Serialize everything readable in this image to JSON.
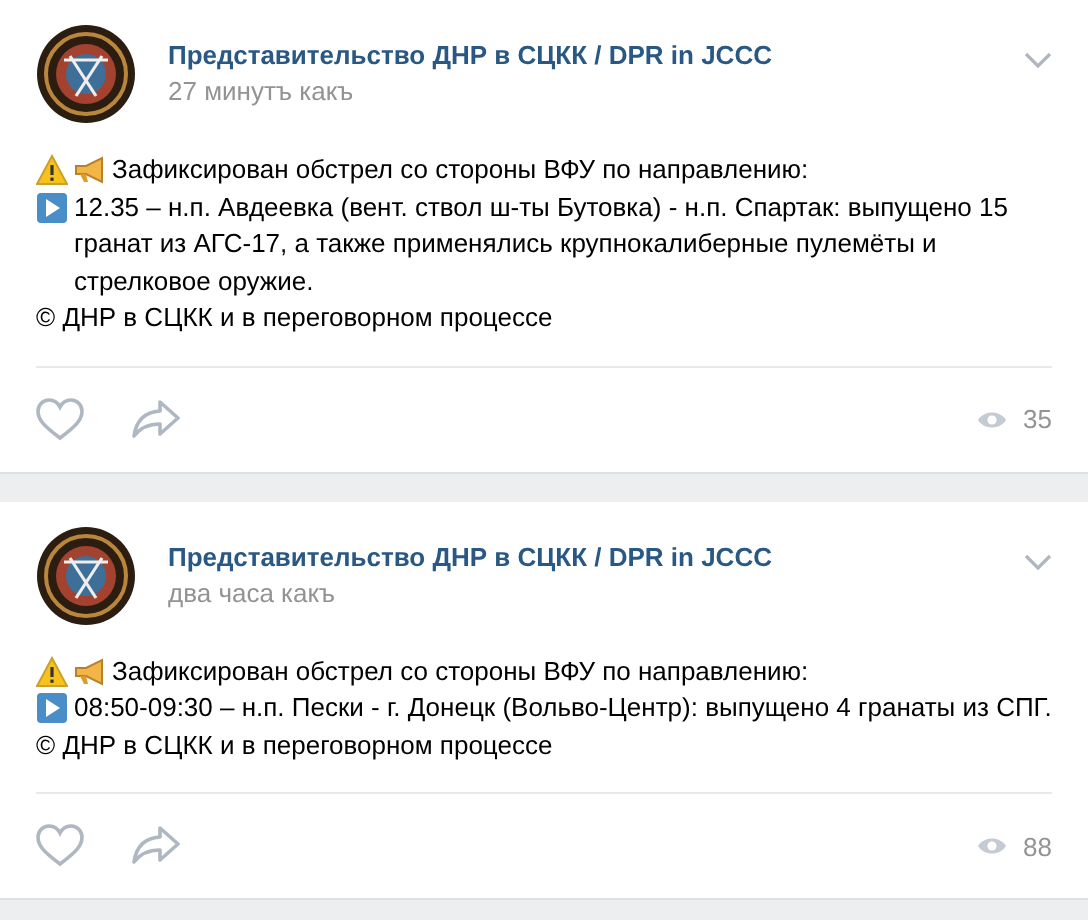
{
  "posts": [
    {
      "author": "Представительство ДНР в СЦКК / DPR in JCCC",
      "time": "27 минутъ какъ",
      "headline": "Зафиксирован обстрел со стороны ВФУ по направлению:",
      "report": "12.35 – н.п. Авдеевка (вент. ствол ш-ты Бутовка) - н.п. Спартак: выпущено 15 гранат из АГС-17, а также применялись крупнокалиберные пулемёты и стрелковое оружие.",
      "credit": "© ДНР в СЦКК и в переговорном процессе",
      "views": "35"
    },
    {
      "author": "Представительство ДНР в СЦКК / DPR in JCCC",
      "time": "два часа какъ",
      "headline": "Зафиксирован обстрел со стороны ВФУ по направлению:",
      "report": "08:50-09:30 – н.п. Пески - г. Донецк (Вольво-Центр): выпущено 4 гранаты из СПГ.",
      "credit": "© ДНР в СЦКК и в переговорном процессе",
      "views": "88"
    }
  ]
}
